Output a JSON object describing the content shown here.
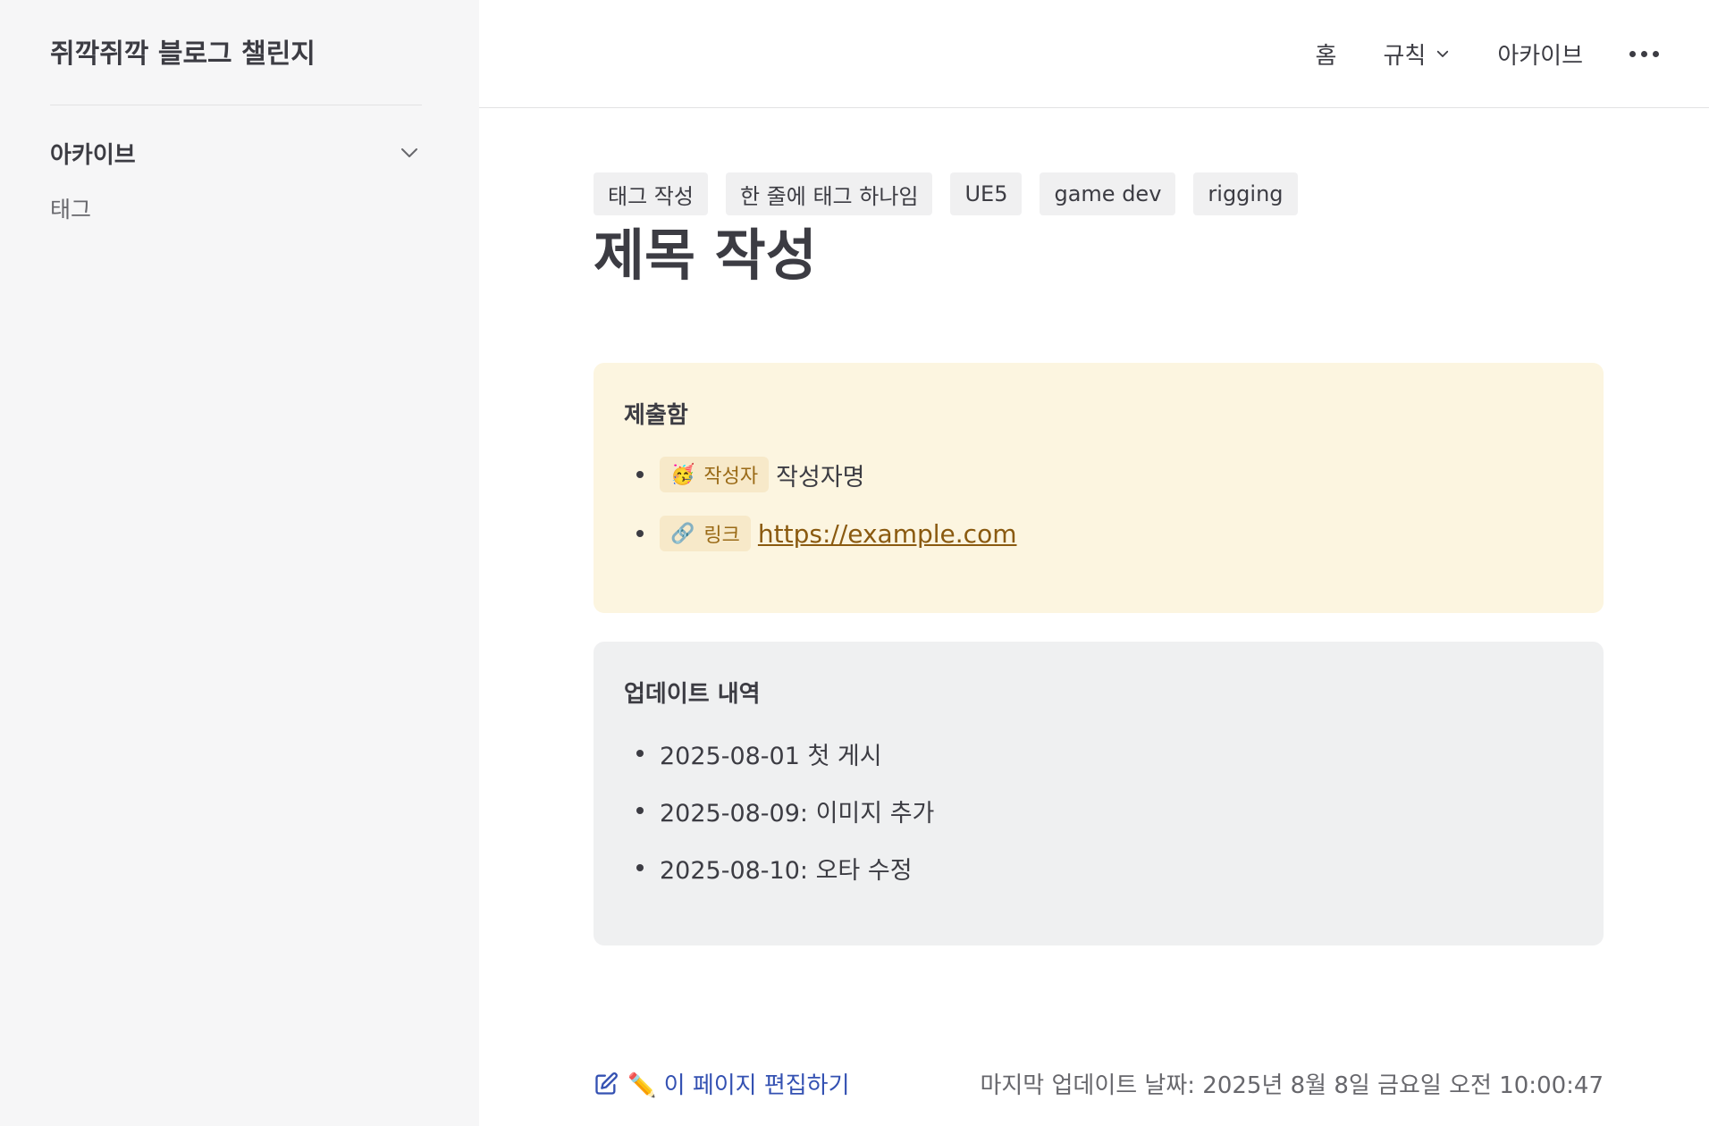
{
  "sidebar": {
    "site_title": "쥐깍쥐깍 블로그 챌린지",
    "group_label": "아카이브",
    "items": [
      {
        "label": "태그"
      }
    ]
  },
  "nav": {
    "home": "홈",
    "rules": "규칙",
    "archive": "아카이브"
  },
  "page": {
    "tags": [
      "태그 작성",
      "한 줄에 태그 하나임",
      "UE5",
      "game dev",
      "rigging"
    ],
    "title": "제목 작성"
  },
  "submission": {
    "title": "제출함",
    "author_chip": {
      "emoji": "🥳",
      "label": "작성자"
    },
    "author_value": "작성자명",
    "link_chip": {
      "emoji": "🔗",
      "label": "링크"
    },
    "link_value": "https://example.com"
  },
  "updates": {
    "title": "업데이트 내역",
    "items": [
      "2025-08-01 첫 게시",
      "2025-08-09: 이미지 추가",
      "2025-08-10: 오타 수정"
    ]
  },
  "footer": {
    "edit_label": "✏️ 이 페이지 편집하기",
    "last_updated": "마지막 업데이트 날짜: 2025년 8월 8일 금요일 오전 10:00:47"
  },
  "colors": {
    "accent": "#3451b2",
    "submit_bg": "#fcf5e0",
    "update_bg": "#eff0f1",
    "sidebar_bg": "#f6f6f7"
  }
}
